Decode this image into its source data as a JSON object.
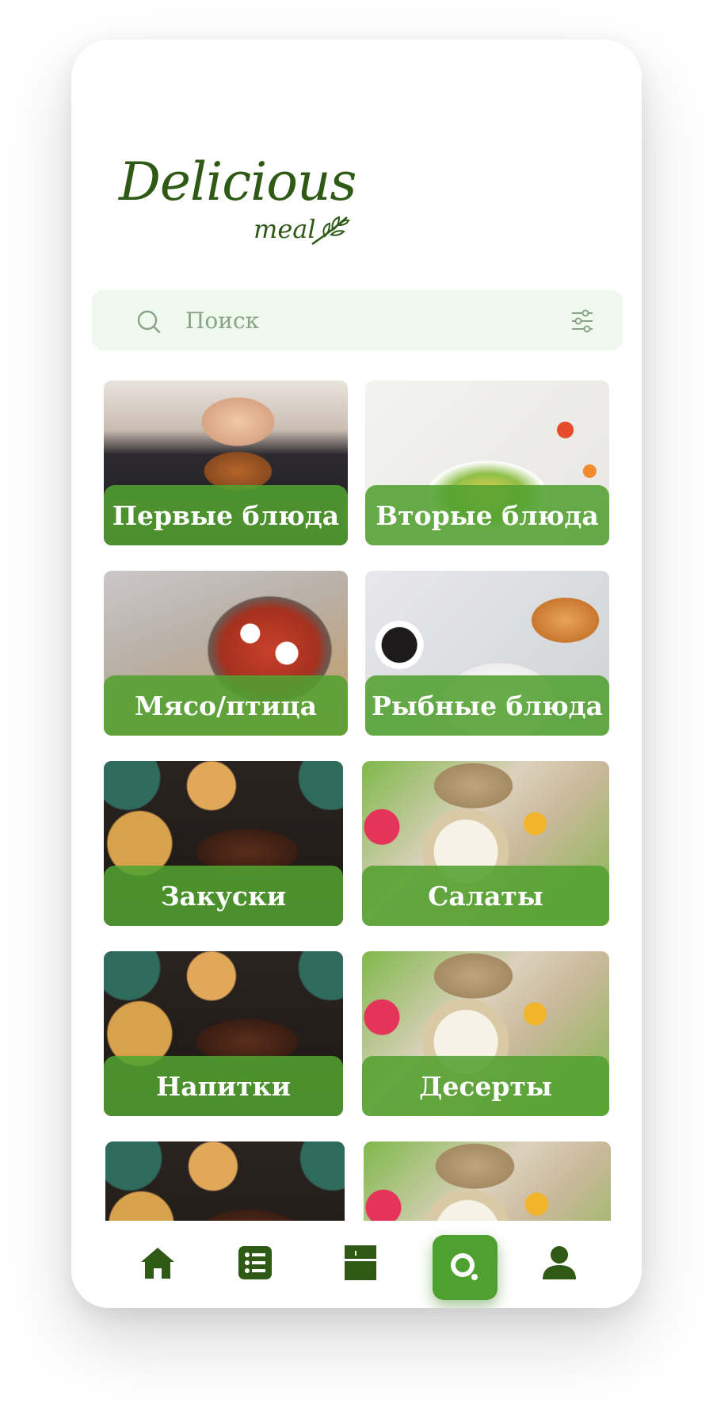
{
  "app": {
    "logo_main": "Delicious",
    "logo_sub": "meal",
    "accent_color": "#4ea12e",
    "dark_green": "#2f5a16"
  },
  "search": {
    "placeholder": "Поиск",
    "icon": "search-icon",
    "filter_icon": "filter-icon"
  },
  "categories": [
    {
      "label": "Первые блюда",
      "image": "burger-photo"
    },
    {
      "label": "Вторые блюда",
      "image": "salad-plate-photo"
    },
    {
      "label": "Мясо/птица",
      "image": "shakshuka-pan-photo"
    },
    {
      "label": "Рыбные блюда",
      "image": "pancakes-photo"
    },
    {
      "label": "Закуски",
      "image": "feast-table-photo"
    },
    {
      "label": "Салаты",
      "image": "dip-platter-photo"
    },
    {
      "label": "Напитки",
      "image": "feast-table-photo"
    },
    {
      "label": "Десерты",
      "image": "dip-platter-photo"
    },
    {
      "label": "",
      "image": "feast-table-photo"
    },
    {
      "label": "",
      "image": "dip-platter-photo"
    }
  ],
  "nav": [
    {
      "icon": "home-icon",
      "active": false
    },
    {
      "icon": "list-icon",
      "active": false
    },
    {
      "icon": "fridge-icon",
      "active": false
    },
    {
      "icon": "search-icon",
      "active": true
    },
    {
      "icon": "user-icon",
      "active": false
    }
  ]
}
